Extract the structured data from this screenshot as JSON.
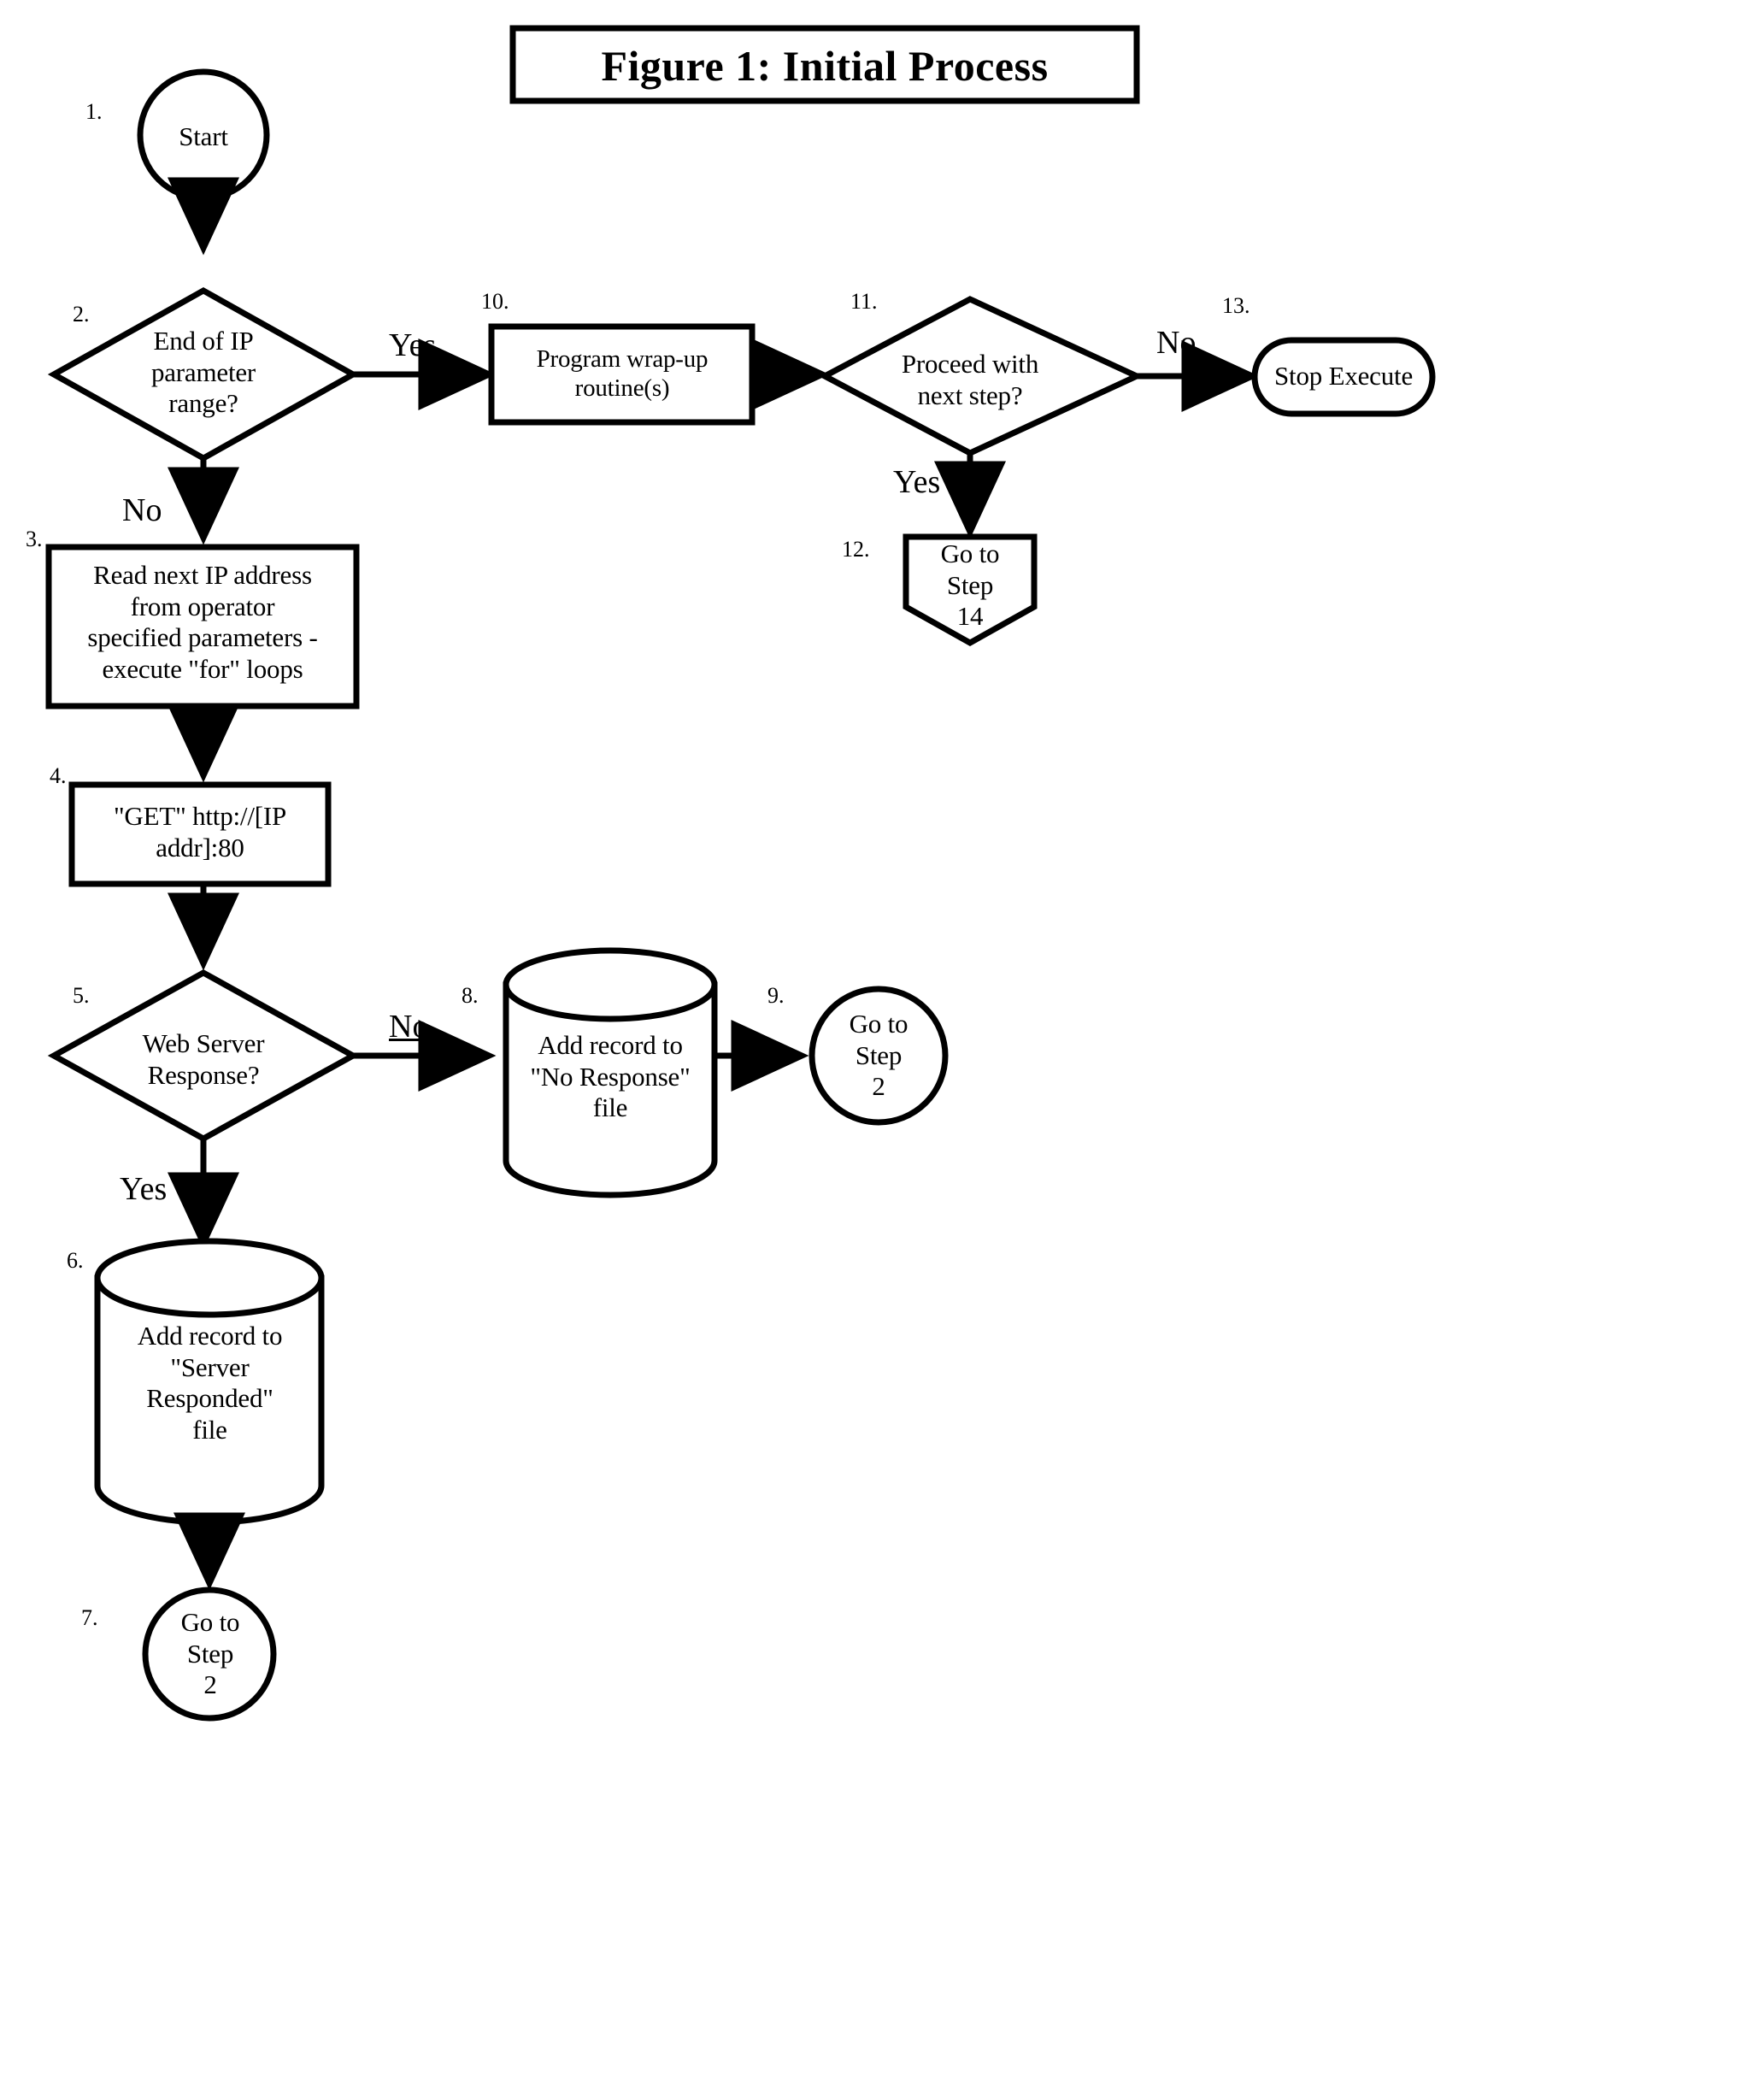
{
  "figure": {
    "title": "Figure 1:  Initial Process",
    "domain": "flowchart"
  },
  "nodes": [
    {
      "id": "n1",
      "number": "1.",
      "shape": "circle",
      "label": "Start"
    },
    {
      "id": "n2",
      "number": "2.",
      "shape": "diamond",
      "label": "End of IP\nparameter\nrange?"
    },
    {
      "id": "n3",
      "number": "3.",
      "shape": "rect",
      "label": "Read next IP address\nfrom operator\nspecified parameters -\nexecute \"for\" loops"
    },
    {
      "id": "n4",
      "number": "4.",
      "shape": "rect",
      "label": "\"GET\" http://[IP\naddr]:80"
    },
    {
      "id": "n5",
      "number": "5.",
      "shape": "diamond",
      "label": "Web Server\nResponse?"
    },
    {
      "id": "n6",
      "number": "6.",
      "shape": "cylinder",
      "label": "Add record to\n\"Server\nResponded\"\nfile"
    },
    {
      "id": "n7",
      "number": "7.",
      "shape": "circle",
      "label": "Go to\nStep\n2"
    },
    {
      "id": "n8",
      "number": "8.",
      "shape": "cylinder",
      "label": "Add record to\n\"No Response\"\nfile"
    },
    {
      "id": "n9",
      "number": "9.",
      "shape": "circle",
      "label": "Go to\nStep\n2"
    },
    {
      "id": "n10",
      "number": "10.",
      "shape": "rect",
      "label": "Program wrap-up\nroutine(s)"
    },
    {
      "id": "n11",
      "number": "11.",
      "shape": "diamond",
      "label": "Proceed with\nnext step?"
    },
    {
      "id": "n12",
      "number": "12.",
      "shape": "pentagon",
      "label": "Go to\nStep\n14"
    },
    {
      "id": "n13",
      "number": "13.",
      "shape": "stadium",
      "label": "Stop Execute"
    }
  ],
  "edge_labels": {
    "e2_yes": "Yes",
    "e2_no": "No",
    "e5_no": "No",
    "e5_yes": "Yes",
    "e11_no": "No",
    "e11_yes": "Yes"
  },
  "style": {
    "stroke": "#000000",
    "fill": "#ffffff",
    "background": "#ffffff"
  }
}
